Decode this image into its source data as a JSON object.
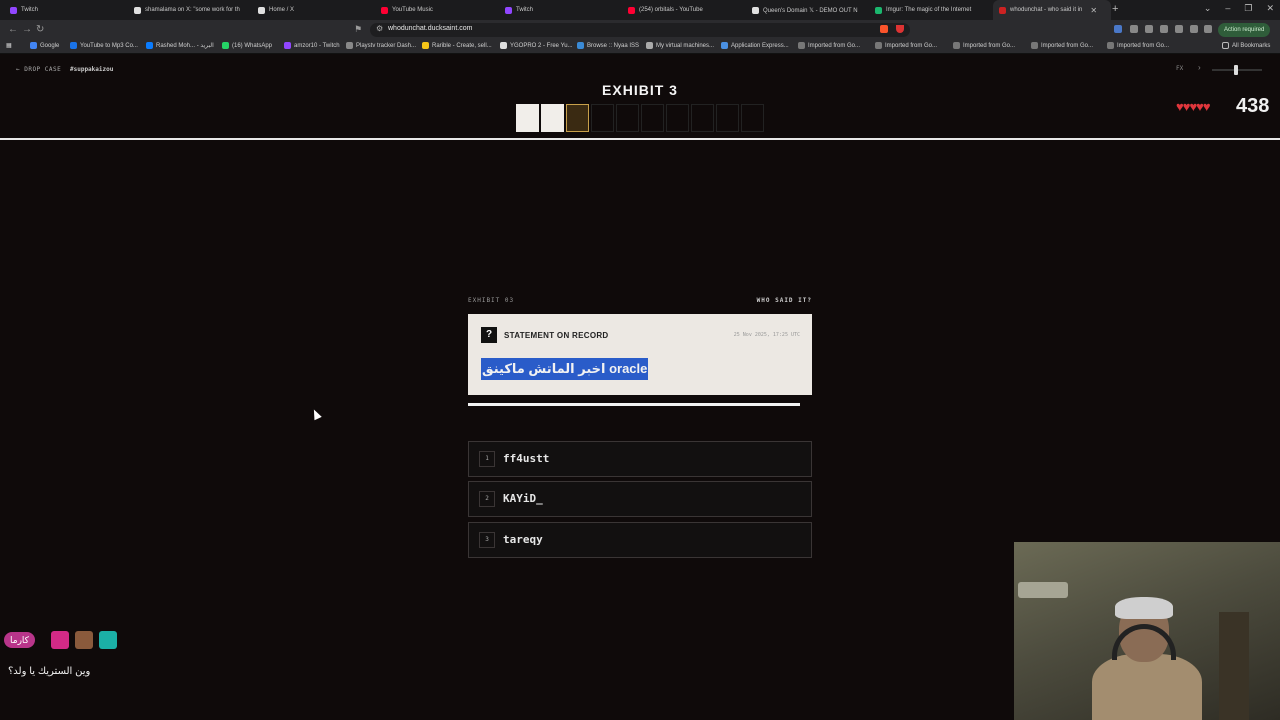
{
  "browser": {
    "tabs": [
      {
        "title": "Twitch",
        "color": "#9146ff"
      },
      {
        "title": "shamalama on X: \"some work for th",
        "color": "#e0e0e0"
      },
      {
        "title": "Home / X",
        "color": "#e0e0e0"
      },
      {
        "title": "YouTube Music",
        "color": "#ff0033"
      },
      {
        "title": "Twitch",
        "color": "#9146ff"
      },
      {
        "title": "(254) orbitals - YouTube",
        "color": "#ff0033"
      },
      {
        "title": "Queen's Domain 𝕏 - DEMO OUT N",
        "color": "#e0e0e0"
      },
      {
        "title": "Imgur: The magic of the Internet",
        "color": "#1bb76e"
      },
      {
        "title": "whodunchat - who said it in",
        "color": "#cc2222"
      }
    ],
    "url": "whodunchat.ducksaint.com",
    "action_required": "Action required",
    "bookmarks": [
      {
        "label": "Google",
        "color": "#4285f4"
      },
      {
        "label": "YouTube to Mp3 Co...",
        "color": "#1a73e8"
      },
      {
        "label": "Rashed Moh... - البريد",
        "color": "#0a7cff"
      },
      {
        "label": "(16) WhatsApp",
        "color": "#25d366"
      },
      {
        "label": "amzor10 - Twitch",
        "color": "#9146ff"
      },
      {
        "label": "Playstv tracker Dash...",
        "color": "#888888"
      },
      {
        "label": "Rarible - Create, sell...",
        "color": "#f5c518"
      },
      {
        "label": "YGOPRO 2 - Free Yu...",
        "color": "#dddddd"
      },
      {
        "label": "Browse :: Nyaa ISS",
        "color": "#3a8ad6"
      },
      {
        "label": "My virtual machines...",
        "color": "#aaaaaa"
      },
      {
        "label": "Application Express...",
        "color": "#4a90e2"
      },
      {
        "label": "Imported from Go...",
        "color": "#777777"
      },
      {
        "label": "Imported from Go...",
        "color": "#777777"
      },
      {
        "label": "Imported from Go...",
        "color": "#777777"
      },
      {
        "label": "Imported from Go...",
        "color": "#777777"
      },
      {
        "label": "Imported from Go...",
        "color": "#777777"
      }
    ],
    "all_bookmarks": "All Bookmarks"
  },
  "game": {
    "back_label": "← DROP CASE",
    "handle": "#suppakaizou",
    "exhibit_title": "EXHIBIT 3",
    "progress": {
      "done": 2,
      "current": 1,
      "total": 10
    },
    "fx_label": "FX",
    "hearts": "♥♥♥♥♥",
    "score": "438",
    "exhibit_label": "EXHIBIT 03",
    "question": "WHO SAID IT?",
    "statement_label": "STATEMENT ON RECORD",
    "statement_date": "25 Nov 2025, 17:25 UTC",
    "quote": "اخبر الماتش ماكينق oracle",
    "options": [
      {
        "num": "1",
        "name": "ff4ustt"
      },
      {
        "num": "2",
        "name": "KAYiD_"
      },
      {
        "num": "3",
        "name": "tareqy"
      }
    ]
  },
  "overlay": {
    "karma_label": "كارما",
    "chat_message": "وين الستريك يا ولد؟"
  }
}
